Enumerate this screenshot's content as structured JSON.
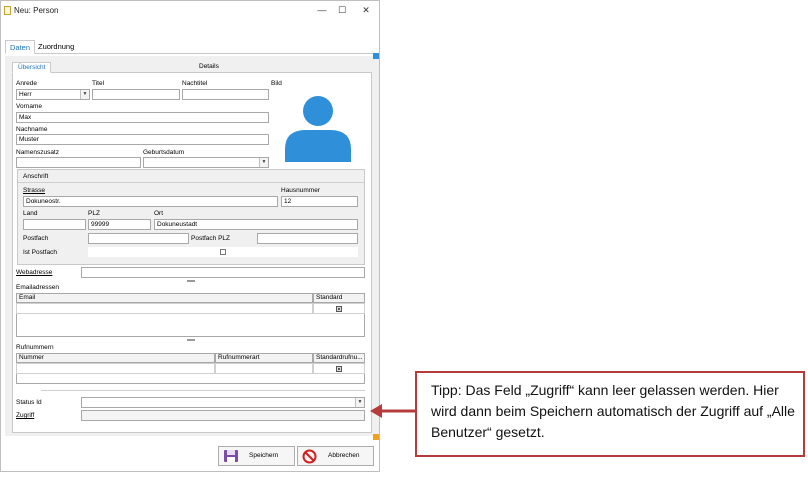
{
  "window": {
    "title": "Neu: Person",
    "controls": {
      "minimize": "—",
      "maximize": "☐",
      "close": "✕"
    }
  },
  "outer_tabs": [
    {
      "label": "Daten",
      "active": true
    },
    {
      "label": "Zuordnung",
      "active": false
    }
  ],
  "inner_tabs": [
    {
      "label": "Übersicht",
      "active": true
    },
    {
      "label": "Details",
      "active": false
    }
  ],
  "form": {
    "anrede": {
      "label": "Anrede",
      "value": "Herr"
    },
    "titel": {
      "label": "Titel",
      "value": ""
    },
    "nachtitel": {
      "label": "Nachtitel",
      "value": ""
    },
    "bild": {
      "label": "Bild"
    },
    "vorname": {
      "label": "Vorname",
      "value": "Max"
    },
    "nachname": {
      "label": "Nachname",
      "value": "Muster"
    },
    "namenszusatz": {
      "label": "Namenszusatz",
      "value": ""
    },
    "geburtsdatum": {
      "label": "Geburtsdatum",
      "value": ""
    }
  },
  "anschrift": {
    "title": "Anschrift",
    "strasse": {
      "label": "Strasse",
      "value": "Dokuneostr."
    },
    "hausnummer": {
      "label": "Hausnummer",
      "value": "12"
    },
    "land": {
      "label": "Land",
      "value": ""
    },
    "plz": {
      "label": "PLZ",
      "value": "99999"
    },
    "ort": {
      "label": "Ort",
      "value": "Dokuneustadt"
    },
    "postfach": {
      "label": "Postfach",
      "value": ""
    },
    "postfach_plz": {
      "label": "Postfach PLZ",
      "value": ""
    },
    "ist_postfach": {
      "label": "Ist Postfach",
      "checked": false
    }
  },
  "webadresse": {
    "label": "Webadresse",
    "value": ""
  },
  "emails": {
    "label": "Emailadressen",
    "columns": [
      "Email",
      "Standard"
    ]
  },
  "phones": {
    "label": "Rufnummern",
    "columns": [
      "Nummer",
      "Rufnummerart",
      "Standardrufnu..."
    ]
  },
  "status": {
    "label": "Status Id",
    "value": ""
  },
  "zugriff": {
    "label": "Zugriff",
    "value": ""
  },
  "buttons": {
    "save": "Speichern",
    "cancel": "Abbrechen"
  },
  "callout": {
    "text": "Tipp: Das Feld „Zugriff“ kann leer gelassen werden. Hier wird dann beim Speichern automatisch der Zugriff auf „Alle Benutzer“ gesetzt."
  },
  "colors": {
    "accent": "#1e73be",
    "avatar": "#2f8fd8",
    "callout_border": "#b63b3b"
  }
}
